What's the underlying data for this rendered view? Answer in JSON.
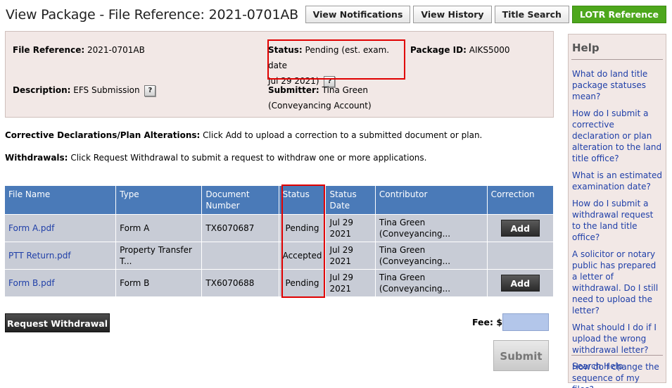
{
  "page": {
    "title": "View Package - File Reference: 2021-0701AB"
  },
  "tabs": [
    {
      "label": "View Notifications"
    },
    {
      "label": "View History"
    },
    {
      "label": "Title Search"
    },
    {
      "label": "LOTR Reference"
    }
  ],
  "package": {
    "file_reference_label": "File Reference:",
    "file_reference_value": "2021-0701AB",
    "status_label": "Status:",
    "status_value": "Pending (est. exam. date",
    "status_value_line2": "Jul 29 2021)",
    "package_id_label": "Package ID:",
    "package_id_value": "AIKS5000",
    "description_label": "Description:",
    "description_value": "EFS Submission",
    "submitter_label": "Submitter:",
    "submitter_value": "Tina Green",
    "submitter_value_line2": "(Conveyancing Account)",
    "help_glyph": "?"
  },
  "notes": {
    "corrective_label": "Corrective Declarations/Plan Alterations:",
    "corrective_text": "Click Add to upload a correction to a submitted document or plan.",
    "withdrawals_label": "Withdrawals:",
    "withdrawals_text": "Click Request Withdrawal to submit a request to withdraw one or more applications."
  },
  "table": {
    "headers": [
      "File Name",
      "Type",
      "Document Number",
      "Status",
      "Status Date",
      "Contributor",
      "Correction"
    ],
    "rows": [
      {
        "file_name": "Form A.pdf",
        "type": "Form A",
        "doc_number": "TX6070687",
        "status": "Pending",
        "status_date": "Jul 29 2021",
        "contributor": "Tina Green (Conveyancing...",
        "correction": "Add"
      },
      {
        "file_name": "PTT Return.pdf",
        "type": "Property Transfer T...",
        "doc_number": "",
        "status": "Accepted",
        "status_date": "Jul 29 2021",
        "contributor": "Tina Green (Conveyancing...",
        "correction": ""
      },
      {
        "file_name": "Form B.pdf",
        "type": "Form B",
        "doc_number": "TX6070688",
        "status": "Pending",
        "status_date": "Jul 29 2021",
        "contributor": "Tina Green (Conveyancing...",
        "correction": "Add"
      }
    ]
  },
  "actions": {
    "request_withdrawal": "Request Withdrawal",
    "fee_label": "Fee: $",
    "fee_value": "",
    "submit": "Submit"
  },
  "help": {
    "title": "Help",
    "links": [
      "What do land title package statuses mean?",
      "How do I submit a corrective declaration or plan alteration to the land title office?",
      "What is an estimated examination date?",
      "How do I submit a withdrawal request to the land title office?",
      "A solicitor or notary public has prepared a letter of withdrawal. Do I still need to upload the letter?",
      "What should I do if I upload the wrong withdrawal letter?",
      "How do I change the sequence of my files?"
    ],
    "search_help": "Search Help"
  },
  "colors": {
    "table_header": "#4a7ab8",
    "table_row": "#c8ccd6",
    "panel_bg": "#f2e8e6",
    "highlight": "#e00000",
    "lotr_tab": "#4da71c",
    "link": "#1f3fa8"
  }
}
